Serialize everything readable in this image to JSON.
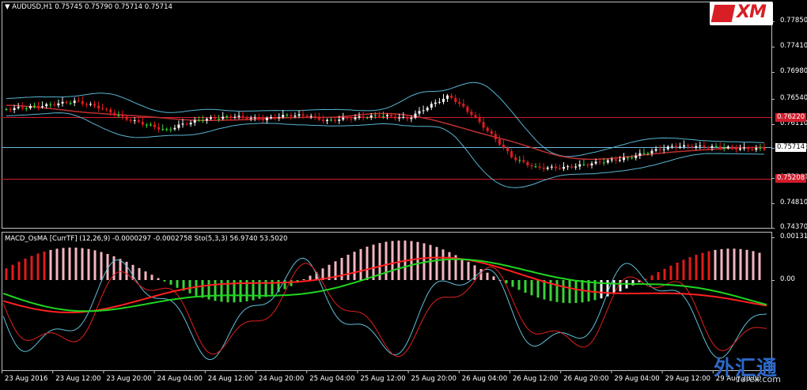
{
  "header": {
    "symbol": "AUDUSD,H1",
    "ohlc": "0.75745 0.75790 0.75714 0.75714",
    "dropdown_glyph": "▼"
  },
  "indicator": {
    "title": "MACD_OsMA [CurrTF] (12,26,9) -0.0000297 -0.0002758  Sto(5,3,3) 56.9740 53.5020",
    "axis": [
      "0.001312",
      "0.00"
    ]
  },
  "price_axis": [
    "0.77850",
    "0.77410",
    "0.76980",
    "0.76540",
    "0.76110",
    "0.75680",
    "0.75240",
    "0.74810",
    "0.74370"
  ],
  "price_tags": {
    "upper": {
      "text": "0.76220",
      "color": "#d01c2a"
    },
    "current": {
      "text": "0.75714",
      "color": "#ffffff"
    },
    "lower": {
      "text": "0.75208",
      "color": "#d01c2a"
    }
  },
  "time_axis": [
    "23 Aug 2016",
    "23 Aug 12:00",
    "23 Aug 20:00",
    "24 Aug 04:00",
    "24 Aug 12:00",
    "24 Aug 20:00",
    "25 Aug 04:00",
    "25 Aug 12:00",
    "25 Aug 20:00",
    "26 Aug 04:00",
    "26 Aug 12:00",
    "26 Aug 20:00",
    "29 Aug 04:00",
    "29 Aug 12:00",
    "29 Aug 20:00"
  ],
  "logo": {
    "text": "XM"
  },
  "watermark": {
    "cn": "外汇通",
    "domain": "forex.com"
  },
  "colors": {
    "bull": "#f5f5f5",
    "bear": "#e31a1c",
    "doji": "#39d339",
    "bands": "#57b5d3",
    "ma": "#c03030",
    "macd_main": "#ff2020",
    "macd_signal": "#1fd61f",
    "sto_k": "#5fc0d8",
    "sto_d": "#e02020",
    "hist_pos": "#e31a1c",
    "hist_pos_weak": "#f3b6c0",
    "hist_neg": "#39d339",
    "hist_neg_weak": "#f5f5f5",
    "grid": "#c0c0c0"
  }
}
